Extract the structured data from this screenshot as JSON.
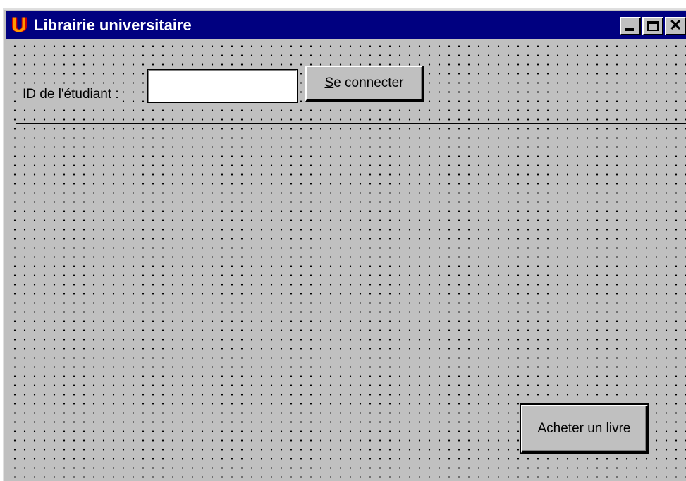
{
  "window": {
    "title": "Librairie universitaire",
    "icon_name": "app-u-icon",
    "icon_letter": "U",
    "controls": {
      "minimize_icon": "minimize-icon",
      "maximize_icon": "maximize-icon",
      "close_icon": "close-icon",
      "close_glyph": "✕"
    }
  },
  "form": {
    "student_id_label": "ID de l'étudiant :",
    "student_id_value": "",
    "student_id_placeholder": "",
    "connect_button": {
      "mnemonic": "S",
      "rest": "e connecter"
    },
    "buy_button_label": "Acheter un livre"
  },
  "colors": {
    "titlebar": "#000080",
    "face": "#c0c0c0",
    "icon_accent": "#ff9900"
  }
}
